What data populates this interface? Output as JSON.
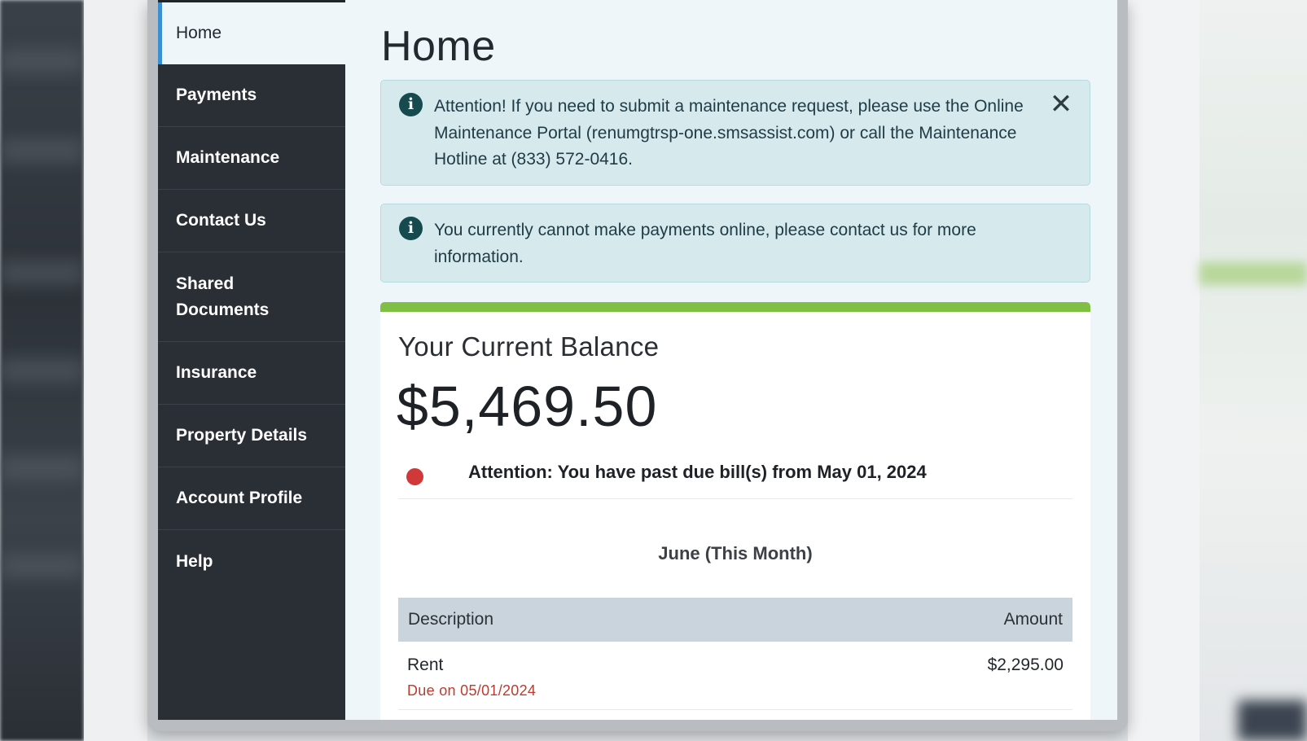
{
  "sidebar": {
    "items": [
      {
        "label": "Home",
        "active": true
      },
      {
        "label": "Payments"
      },
      {
        "label": "Maintenance"
      },
      {
        "label": "Contact Us"
      },
      {
        "label": "Shared Documents"
      },
      {
        "label": "Insurance"
      },
      {
        "label": "Property Details"
      },
      {
        "label": "Account Profile"
      },
      {
        "label": "Help"
      }
    ]
  },
  "page": {
    "title": "Home"
  },
  "alerts": [
    {
      "icon": "info-icon",
      "text": "Attention! If you need to submit a maintenance request, please use the Online Maintenance Portal (renumgtrsp-one.smsassist.com) or call the Maintenance Hotline at (833) 572-0416.",
      "dismissible": true
    },
    {
      "icon": "info-icon",
      "text": "You currently cannot make payments online, please contact us for more information."
    }
  ],
  "balance_card": {
    "title": "Your Current Balance",
    "amount": "$5,469.50",
    "past_due_notice": "Attention: You have past due bill(s) from May 01, 2024",
    "month_label": "June (This Month)",
    "table": {
      "headers": {
        "description": "Description",
        "amount": "Amount"
      },
      "rows": [
        {
          "description": "Rent",
          "due": "Due on 05/01/2024",
          "amount": "$2,295.00"
        }
      ]
    }
  },
  "colors": {
    "sidebar_bg": "#2a2f35",
    "active_accent": "#3b8fd3",
    "alert_bg": "#d6eaee",
    "card_bar": "#7fbf44",
    "past_due_dot": "#d0383a",
    "due_text": "#c0392b"
  }
}
